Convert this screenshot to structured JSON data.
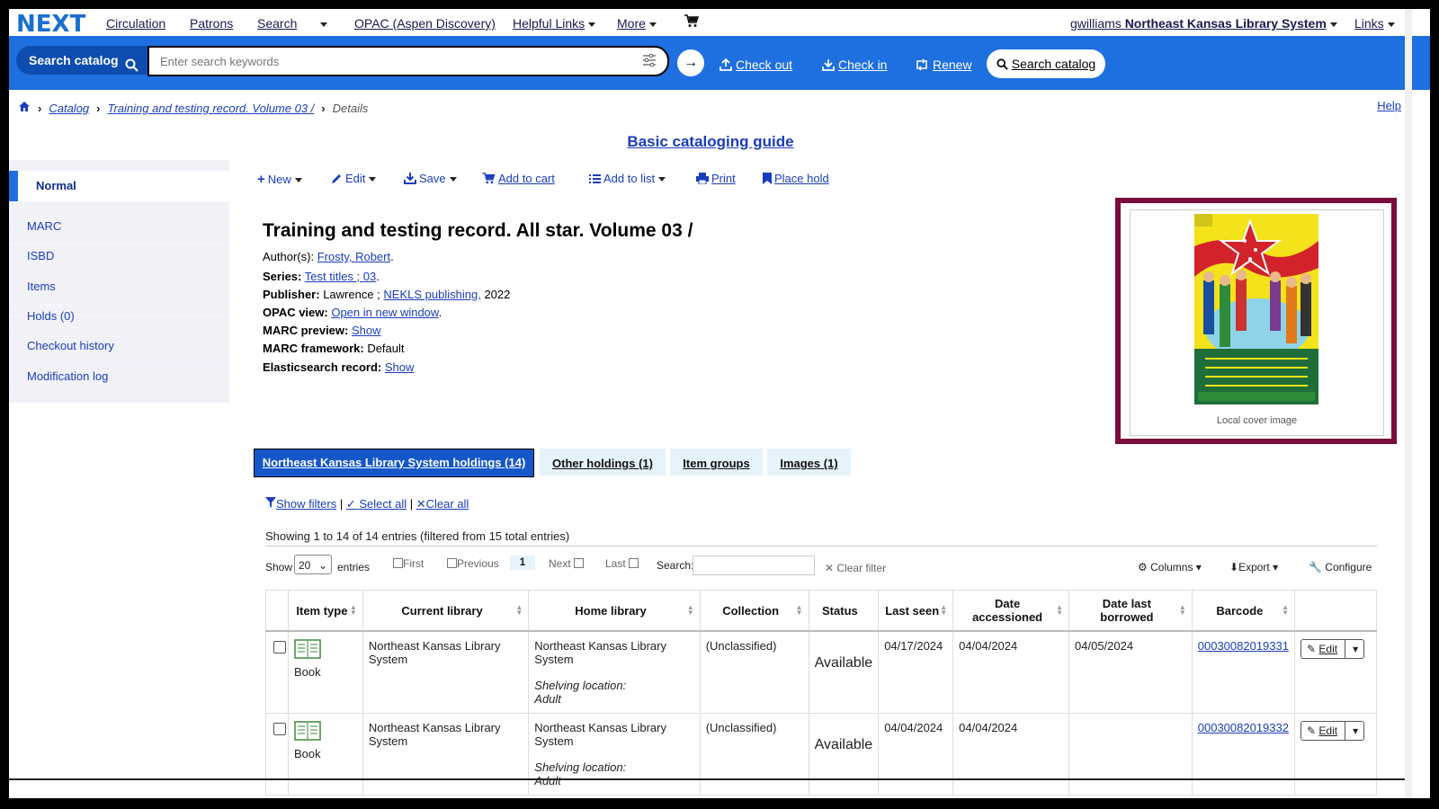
{
  "topnav": {
    "logo": "NEXT",
    "items": [
      "Circulation",
      "Patrons",
      "Search",
      "OPAC (Aspen Discovery)",
      "Helpful Links",
      "More"
    ],
    "user": "gwilliams",
    "library": "Northeast Kansas Library System",
    "links": "Links"
  },
  "bluebar": {
    "search_label": "Search catalog",
    "search_placeholder": "Enter search keywords",
    "checkout": "Check out",
    "checkin": "Check in",
    "renew": "Renew",
    "search_catalog": "Search catalog",
    "accent": "#1e6fe0"
  },
  "breadcrumb": {
    "catalog": "Catalog",
    "record": "Training and testing record. Volume 03 /",
    "current": "Details"
  },
  "help": "Help",
  "guide": "Basic cataloging guide",
  "sidebar": {
    "items": [
      "Normal",
      "MARC",
      "ISBD",
      "Items",
      "Holds (0)",
      "Checkout history",
      "Modification log"
    ]
  },
  "toolbar": {
    "new": "New",
    "edit": "Edit",
    "save": "Save",
    "add_to_cart": "Add to cart",
    "add_to_list": "Add to list",
    "print": "Print",
    "place_hold": "Place hold"
  },
  "record": {
    "title": "Training and testing record. All star. Volume 03 /",
    "author_label": "Author(s):",
    "author": "Frosty, Robert",
    "series_label": "Series:",
    "series": "Test titles ; 03",
    "publisher_label": "Publisher:",
    "publisher_place": "Lawrence ;",
    "publisher_name": "NEKLS publishing,",
    "publisher_year": "2022",
    "opac_label": "OPAC view:",
    "opac_link": "Open in new window",
    "marc_preview_label": "MARC preview:",
    "marc_preview_link": "Show",
    "framework_label": "MARC framework:",
    "framework": "Default",
    "es_label": "Elasticsearch record:",
    "es_link": "Show"
  },
  "cover": {
    "caption": "Local cover image",
    "border_color": "#7a0d3c"
  },
  "tabs": {
    "holdings": "Northeast Kansas Library System holdings (14)",
    "other": "Other holdings (1)",
    "groups": "Item groups",
    "images": "Images (1)"
  },
  "filters": {
    "show_filters": "Show filters",
    "select_all": "Select all",
    "clear_all": "Clear all"
  },
  "table_info": {
    "showing": "Showing 1 to 14 of 14 entries (filtered from 15 total entries)",
    "show": "Show",
    "page_size": "20",
    "entries": "entries",
    "first": "First",
    "previous": "Previous",
    "page": "1",
    "next": "Next",
    "last": "Last",
    "search": "Search:",
    "clear_filter": "Clear filter",
    "columns": "Columns",
    "export": "Export",
    "configure": "Configure"
  },
  "table": {
    "headers": [
      "Item type",
      "Current library",
      "Home library",
      "Collection",
      "Status",
      "Last seen",
      "Date accessioned",
      "Date last borrowed",
      "Barcode"
    ],
    "rows": [
      {
        "item_type": "Book",
        "current_library": "Northeast Kansas Library System",
        "home_library": "Northeast Kansas Library System",
        "shelving_label": "Shelving location:",
        "shelving": "Adult",
        "collection": "(Unclassified)",
        "status": "Available",
        "last_seen": "04/17/2024",
        "accessioned": "04/04/2024",
        "last_borrowed": "04/05/2024",
        "barcode": "00030082019331",
        "edit": "Edit"
      },
      {
        "item_type": "Book",
        "current_library": "Northeast Kansas Library System",
        "home_library": "Northeast Kansas Library System",
        "shelving_label": "Shelving location:",
        "shelving": "Adult",
        "collection": "(Unclassified)",
        "status": "Available",
        "last_seen": "04/04/2024",
        "accessioned": "04/04/2024",
        "last_borrowed": "",
        "barcode": "00030082019332",
        "edit": "Edit"
      }
    ]
  }
}
